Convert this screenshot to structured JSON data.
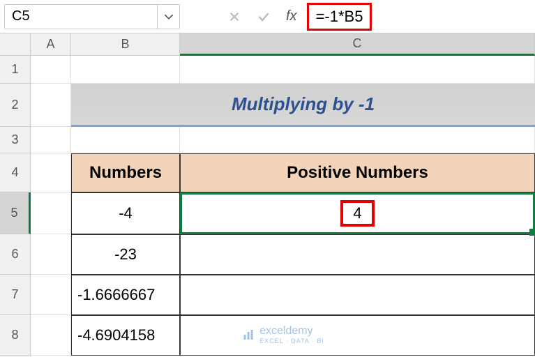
{
  "nameBox": "C5",
  "formula": "=-1*B5",
  "fxLabel": "fx",
  "columns": {
    "a": "A",
    "b": "B",
    "c": "C"
  },
  "rows": [
    "1",
    "2",
    "3",
    "4",
    "5",
    "6",
    "7",
    "8"
  ],
  "title": "Multiplying by -1",
  "headers": {
    "numbers": "Numbers",
    "positive": "Positive Numbers"
  },
  "data": {
    "b5": "-4",
    "b6": "-23",
    "b7": "-1.6666667",
    "b8": "-4.6904158",
    "c5": "4"
  },
  "watermark": {
    "text": "exceldemy",
    "sub": "EXCEL · DATA · BI"
  }
}
